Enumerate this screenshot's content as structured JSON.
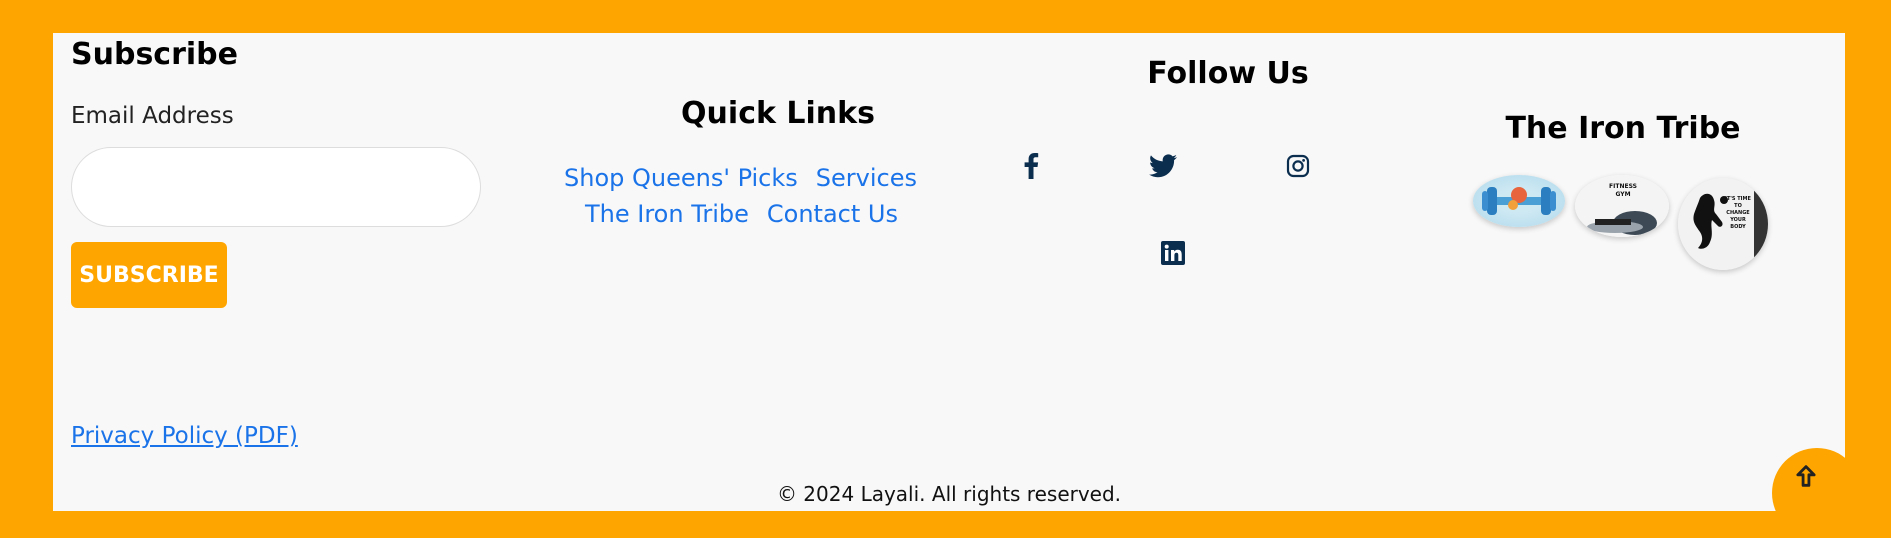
{
  "subscribe": {
    "title": "Subscribe",
    "email_label": "Email Address",
    "email_value": "",
    "button_label": "SUBSCRIBE"
  },
  "quick_links": {
    "title": "Quick Links",
    "items": [
      "Shop Queens' Picks",
      "Services",
      "The Iron Tribe",
      "Contact Us"
    ]
  },
  "follow": {
    "title": "Follow Us",
    "icons": [
      "facebook-icon",
      "twitter-icon",
      "instagram-icon",
      "linkedin-icon"
    ]
  },
  "tribe": {
    "title": "The Iron Tribe",
    "photo2_text": "FITNESS GYM",
    "photo3_text": "IT'S TIME TO CHANGE YOUR BODY"
  },
  "footer": {
    "privacy_label": "Privacy Policy (PDF)",
    "copyright": "© 2024 Layali. All rights reserved."
  },
  "colors": {
    "accent": "#ffa500",
    "link": "#1a73e8",
    "social_icon": "#0b2e4f",
    "panel_bg": "#f8f8f8"
  }
}
